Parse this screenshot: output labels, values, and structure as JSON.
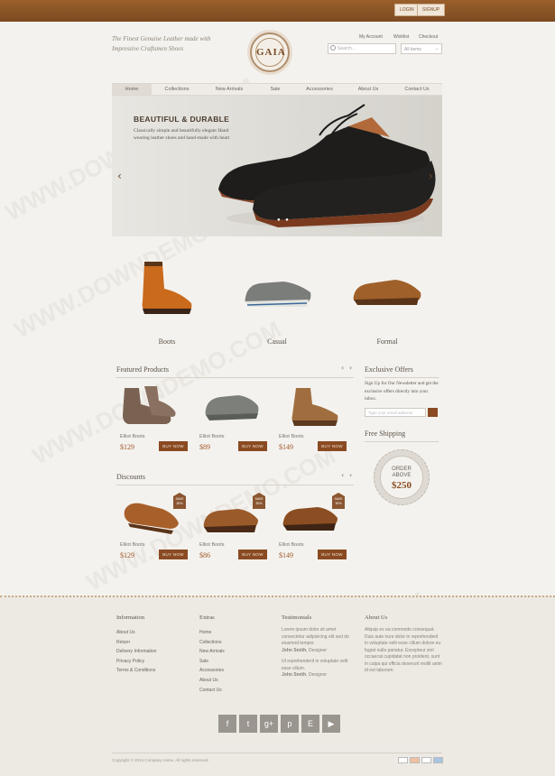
{
  "header": {
    "login": "LOGIN",
    "signup": "SIGNUP",
    "tagline": "The Finest Genuine Leather made with Impressive Craftsmen Shoes",
    "logo": "GAIA",
    "links": [
      "My Account",
      "Wishlist",
      "Checkout"
    ],
    "search_placeholder": "Search...",
    "select_value": "All items"
  },
  "nav": [
    "Home",
    "Collections",
    "New Arrivals",
    "Sale",
    "Accessories",
    "About Us",
    "Contact Us"
  ],
  "hero": {
    "title": "BEAUTIFUL & DURABLE",
    "text": "Classically simple and beautifully elegant Hand wearing leather shoes and hand-made with heart"
  },
  "categories": [
    "Boots",
    "Casual",
    "Formal"
  ],
  "featured": {
    "title": "Featured Products",
    "items": [
      {
        "name": "Elliot Boots",
        "price": "$129",
        "button": "BUY NOW"
      },
      {
        "name": "Elliot Boots",
        "price": "$89",
        "button": "BUY NOW"
      },
      {
        "name": "Elliot Boots",
        "price": "$149",
        "button": "BUY NOW"
      }
    ]
  },
  "discounts": {
    "title": "Discounts",
    "tag": "SAVE 30%",
    "items": [
      {
        "name": "Elliot Boots",
        "price": "$129",
        "button": "BUY NOW"
      },
      {
        "name": "Elliot Boots",
        "price": "$86",
        "button": "BUY NOW"
      },
      {
        "name": "Elliot Boots",
        "price": "$149",
        "button": "BUY NOW"
      }
    ]
  },
  "sidebar": {
    "offers_title": "Exclusive Offers",
    "offers_text": "Sign Up for Our Newsletter and get the exclusive offers directly into your inbox.",
    "email_placeholder": "Type your email address",
    "shipping_title": "Free Shipping",
    "badge_line1": "ORDER",
    "badge_line2": "ABOVE",
    "badge_value": "$250"
  },
  "footer": {
    "info_title": "Information",
    "info_links": [
      "About Us",
      "Return",
      "Delivery Information",
      "Privacy Policy",
      "Terms & Conditions"
    ],
    "extras_title": "Extras",
    "extras_links": [
      "Home",
      "Collections",
      "New Arrivals",
      "Sale",
      "Accessories",
      "About Us",
      "Contact Us"
    ],
    "testimonials_title": "Testimonials",
    "testimonial1": "Lorem ipsum dolor sit amet consectetur adipisicing elit sed do eiusmod tempor.",
    "author1": "John Smith",
    "author1_role": ", Designer",
    "testimonial2": "Ut reprehenderit in voluptate velit esse cillum.",
    "author2": "John Smith",
    "author2_role": ", Designer",
    "about_title": "About Us",
    "about_text": "Aliquip ex ea commodo consequat. Duis aute irure dolor in reprehenderit in voluptate velit esse cillum dolore eu fugiat nulla pariatur. Excepteur sint occaecat cupidatat non proident, sunt in culpa qui officia deserunt mollit anim id est laborum.",
    "social": [
      "f",
      "t",
      "g+",
      "p",
      "E",
      "▶"
    ],
    "copyright": "Copyright © 2014 Company name. All rights reserved."
  },
  "watermark": "WWW.DOWNDEMO.COM",
  "colors": {
    "brand_brown": "#8a4a22",
    "topbar": "#7c4a20",
    "background": "#f4f2ee"
  }
}
